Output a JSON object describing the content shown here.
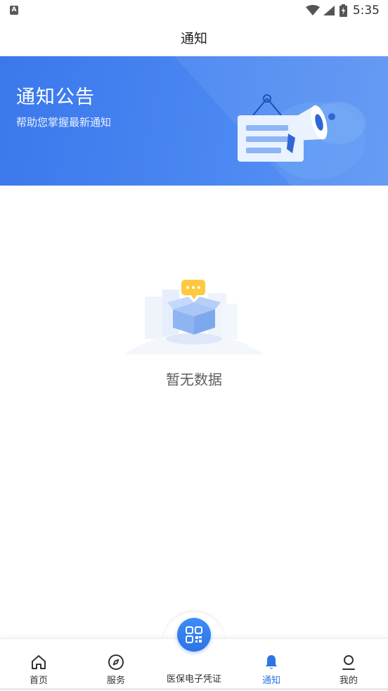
{
  "status_bar": {
    "left_icon_letter": "A",
    "time": "5:35",
    "icons": [
      "wifi-icon",
      "signal-icon",
      "battery-icon"
    ]
  },
  "nav": {
    "title": "通知"
  },
  "banner": {
    "title": "通知公告",
    "subtitle": "帮助您掌握最新通知",
    "illustration": "megaphone-icon"
  },
  "empty_state": {
    "illustration": "empty-box-icon",
    "text": "暂无数据"
  },
  "tab_bar": {
    "items": [
      {
        "label": "首页",
        "icon": "home-icon"
      },
      {
        "label": "服务",
        "icon": "compass-icon"
      },
      {
        "label": "医保电子凭证",
        "icon": "qr-code-icon"
      },
      {
        "label": "通知",
        "icon": "bell-icon",
        "active": true
      },
      {
        "label": "我的",
        "icon": "user-icon"
      }
    ]
  },
  "colors": {
    "brand_blue": "#2f74e7",
    "banner_blue": "#4a87f1"
  }
}
